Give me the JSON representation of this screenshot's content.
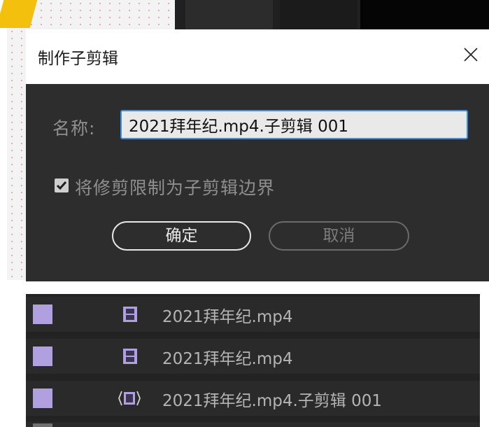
{
  "dialog": {
    "title": "制作子剪辑",
    "name_label": "名称:",
    "name_value": "2021拜年纪.mp4.子剪辑 001",
    "checkbox_label": "将修剪限制为子剪辑边界",
    "checkbox_checked": true,
    "ok_label": "确定",
    "cancel_label": "取消",
    "icons": {
      "close": "close-icon",
      "check": "checkmark-icon"
    }
  },
  "project_list": {
    "items": [
      {
        "name": "2021拜年纪.mp4",
        "icon": "video-clip-icon",
        "label_color": "#b0a0e0"
      },
      {
        "name": "2021拜年纪.mp4",
        "icon": "video-clip-icon",
        "label_color": "#b0a0e0"
      },
      {
        "name": "2021拜年纪.mp4.子剪辑 001",
        "icon": "subclip-icon",
        "label_color": "#b0a0e0"
      }
    ]
  },
  "colors": {
    "accent": "#3d8ee6",
    "dialog_bg": "#2d2d2d",
    "label_purple": "#b0a0e0"
  }
}
